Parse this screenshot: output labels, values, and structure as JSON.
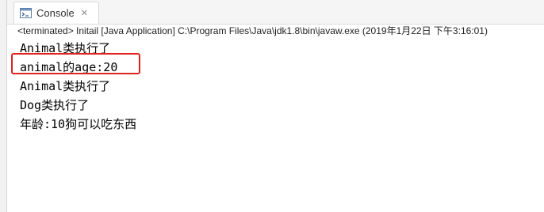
{
  "tab": {
    "label": "Console",
    "icon": "console-icon",
    "close_glyph": "✕"
  },
  "status_line": "<terminated> Initail [Java Application] C:\\Program Files\\Java\\jdk1.8\\bin\\javaw.exe (2019年1月22日 下午3:16:01)",
  "output": [
    "Animal类执行了",
    "animal的age:20",
    "Animal类执行了",
    "Dog类执行了",
    "年龄:10狗可以吃东西"
  ],
  "highlight": {
    "target_line": "animal的age:20",
    "color": "#e0231f"
  }
}
